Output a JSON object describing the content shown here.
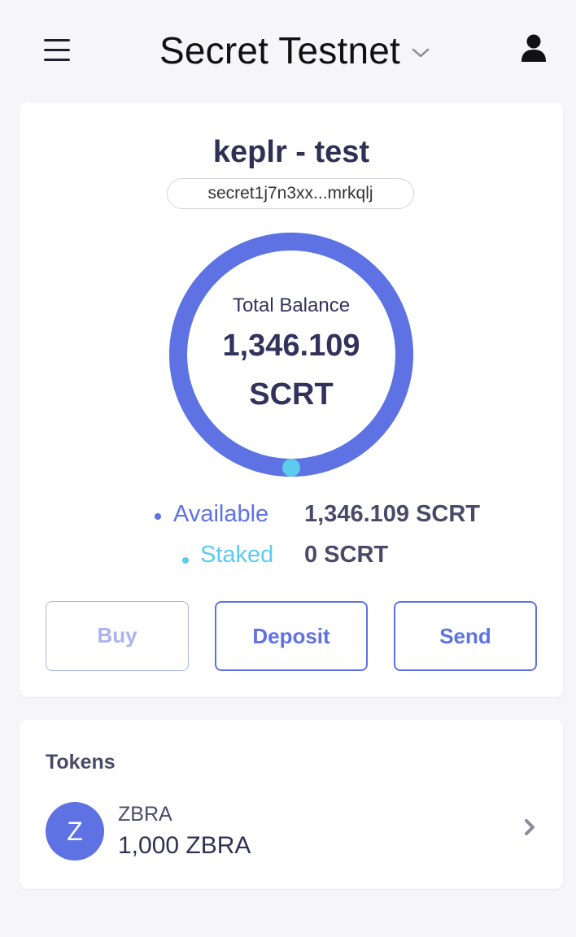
{
  "header": {
    "chain_name": "Secret Testnet"
  },
  "account": {
    "name": "keplr - test",
    "address": "secret1j7n3xx...mrkqlj"
  },
  "balance": {
    "label": "Total Balance",
    "amount": "1,346.109",
    "denom": "SCRT",
    "available_fraction": 1.0
  },
  "legend": {
    "available_label": "Available",
    "available_value": "1,346.109 SCRT",
    "staked_label": "Staked",
    "staked_value": "0 SCRT"
  },
  "actions": {
    "buy": "Buy",
    "deposit": "Deposit",
    "send": "Send"
  },
  "tokens": {
    "title": "Tokens",
    "items": [
      {
        "avatar": "Z",
        "name": "ZBRA",
        "balance": "1,000 ZBRA"
      }
    ]
  },
  "colors": {
    "accent": "#5e72e4",
    "staked": "#5bcbef",
    "text": "#32325d"
  },
  "icons": {
    "menu": "hamburger-menu-icon",
    "chain_dropdown": "chevron-down-icon",
    "account": "user-icon",
    "token_arrow": "chevron-right-icon"
  }
}
